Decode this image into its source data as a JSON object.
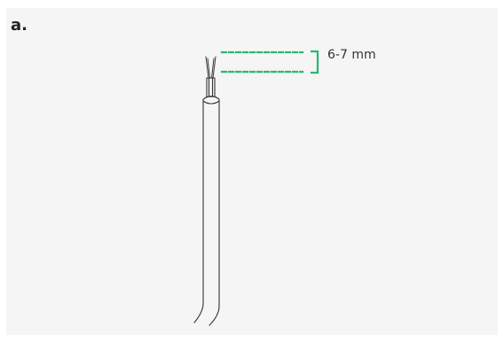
{
  "figure": {
    "step_label": "a.",
    "measurement_label": "6-7 mm"
  },
  "colors": {
    "panel_background": "#f5f5f5",
    "outline": "#333333",
    "guide": "#2bb673"
  }
}
